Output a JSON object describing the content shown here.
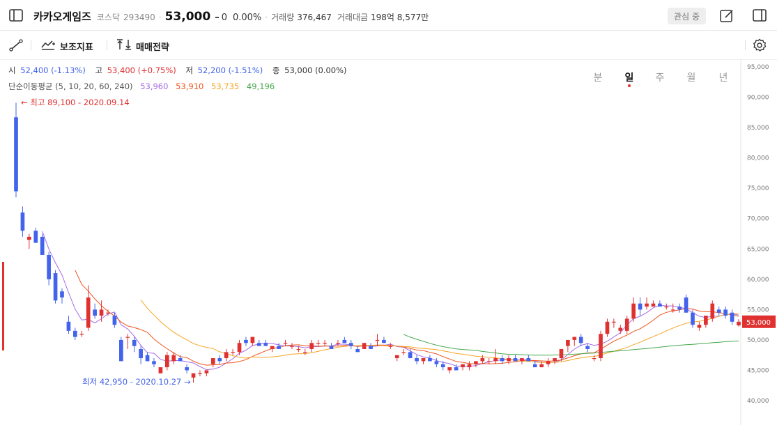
{
  "header": {
    "stock_name": "카카오게임즈",
    "market": "코스닥",
    "code": "293490",
    "price": "53,000",
    "change_arrow": "–",
    "change_value": "0",
    "change_pct": "0.00%",
    "volume_label": "거래량",
    "volume_value": "376,467",
    "amount_label": "거래대금",
    "amount_value": "198억 8,577만",
    "watch_label": "관심 중"
  },
  "toolbar": {
    "indicator_label": "보조지표",
    "strategy_label": "매매전략",
    "periods": [
      "분",
      "일",
      "주",
      "월",
      "년"
    ],
    "active_period": "일"
  },
  "info": {
    "open_label": "시",
    "open_value": "52,400 (-1.13%)",
    "high_label": "고",
    "high_value": "53,400 (+0.75%)",
    "low_label": "저",
    "low_value": "52,200 (-1.51%)",
    "close_label": "종",
    "close_value": "53,000 (0.00%)",
    "ma_label": "단순이동평균 (5, 10, 20, 60, 240)",
    "ma_values": [
      "53,960",
      "53,910",
      "53,735",
      "49,196"
    ]
  },
  "annotations": {
    "max_label": "← 최고 89,100 - 2020.09.14",
    "min_label": "최저 42,950 - 2020.10.27 →",
    "current_price_tag": "53,000"
  },
  "colors": {
    "up": "#e03131",
    "down": "#4263eb",
    "ma5": "#a36ae8",
    "ma10": "#f0531c",
    "ma20": "#f5a524",
    "ma60": "#46a84b"
  },
  "chart_data": {
    "type": "candlestick",
    "y_axis_ticks": [
      "95,000",
      "90,000",
      "85,000",
      "80,000",
      "75,000",
      "70,000",
      "65,000",
      "60,000",
      "55,000",
      "50,000",
      "45,000",
      "40,000"
    ],
    "ylim": [
      40000,
      95000
    ],
    "candles": [
      [
        86700,
        89100,
        73500,
        74500
      ],
      [
        71000,
        72000,
        67000,
        68000
      ],
      [
        66500,
        67500,
        65000,
        67000
      ],
      [
        68000,
        68500,
        66000,
        66000
      ],
      [
        67000,
        67500,
        64000,
        64000
      ],
      [
        64000,
        64500,
        59000,
        60000
      ],
      [
        61000,
        61500,
        56000,
        56500
      ],
      [
        58000,
        58500,
        56000,
        57000
      ],
      [
        53000,
        54000,
        51000,
        51500
      ],
      [
        51500,
        52000,
        50000,
        50500
      ],
      [
        51000,
        51500,
        50500,
        51000
      ],
      [
        52000,
        59000,
        51500,
        57000
      ],
      [
        55000,
        56000,
        53500,
        54000
      ],
      [
        54000,
        56500,
        53000,
        55000
      ],
      [
        54500,
        55000,
        54000,
        54500
      ],
      [
        54000,
        54500,
        52000,
        52500
      ],
      [
        50000,
        50500,
        46500,
        46500
      ],
      [
        50500,
        51000,
        48500,
        50500
      ],
      [
        50000,
        50500,
        48000,
        49000
      ],
      [
        48500,
        49000,
        46000,
        47000
      ],
      [
        47500,
        48000,
        46500,
        46500
      ],
      [
        46500,
        47000,
        45500,
        46000
      ],
      [
        44500,
        45000,
        44500,
        45500
      ],
      [
        45500,
        48000,
        45000,
        47500
      ],
      [
        46500,
        48000,
        46000,
        47500
      ],
      [
        47000,
        47500,
        46500,
        46500
      ],
      [
        45500,
        46000,
        44500,
        45000
      ],
      [
        43800,
        44500,
        42950,
        44500
      ],
      [
        44500,
        45000,
        44000,
        44500
      ],
      [
        44500,
        45000,
        44000,
        45000
      ],
      [
        46000,
        47000,
        45500,
        47000
      ],
      [
        47000,
        47500,
        46000,
        46500
      ],
      [
        47000,
        48500,
        46500,
        48000
      ],
      [
        48000,
        48500,
        47500,
        48000
      ],
      [
        48000,
        50000,
        47500,
        49500
      ],
      [
        50000,
        50500,
        49000,
        49500
      ],
      [
        49500,
        50500,
        49000,
        50500
      ],
      [
        49500,
        50000,
        49000,
        49000
      ],
      [
        49500,
        50000,
        49000,
        49000
      ],
      [
        48500,
        49000,
        48000,
        49000
      ],
      [
        49000,
        49500,
        48500,
        48500
      ],
      [
        49500,
        50000,
        49000,
        49500
      ],
      [
        49000,
        49500,
        48500,
        49000
      ],
      [
        48500,
        49000,
        48000,
        48500
      ],
      [
        48000,
        48500,
        47500,
        48000
      ],
      [
        48500,
        50000,
        48000,
        49500
      ],
      [
        49500,
        50000,
        49000,
        49500
      ],
      [
        49500,
        50000,
        49000,
        49500
      ],
      [
        49000,
        49500,
        48500,
        48500
      ],
      [
        49500,
        50000,
        49000,
        49500
      ],
      [
        50000,
        50500,
        49500,
        49500
      ],
      [
        49500,
        50000,
        48500,
        49000
      ],
      [
        48500,
        49000,
        48000,
        48000
      ],
      [
        48500,
        49500,
        48500,
        49500
      ],
      [
        49000,
        49500,
        48500,
        48500
      ],
      [
        50000,
        51000,
        49000,
        50000
      ],
      [
        50000,
        50500,
        49500,
        49500
      ],
      [
        49000,
        49500,
        48500,
        49000
      ],
      [
        47000,
        47500,
        46500,
        47500
      ],
      [
        48000,
        48500,
        47500,
        48000
      ],
      [
        48000,
        48500,
        47000,
        47000
      ],
      [
        47000,
        47500,
        46000,
        46500
      ],
      [
        46500,
        47000,
        46000,
        47000
      ],
      [
        47000,
        47500,
        46500,
        46500
      ],
      [
        46500,
        47000,
        45500,
        46000
      ],
      [
        46000,
        46500,
        45000,
        45500
      ],
      [
        45000,
        45500,
        44500,
        45500
      ],
      [
        45500,
        46000,
        45000,
        45000
      ],
      [
        45500,
        46000,
        45000,
        46000
      ],
      [
        45500,
        46500,
        45000,
        46000
      ],
      [
        46000,
        46500,
        45500,
        46500
      ],
      [
        46500,
        47500,
        46000,
        47000
      ],
      [
        46500,
        47000,
        46000,
        46500
      ],
      [
        46500,
        48500,
        46000,
        47000
      ],
      [
        47000,
        47500,
        46000,
        46500
      ],
      [
        46500,
        47500,
        46000,
        47000
      ],
      [
        47000,
        47500,
        46500,
        46500
      ],
      [
        46500,
        47000,
        46000,
        47000
      ],
      [
        47000,
        47500,
        46500,
        46500
      ],
      [
        46000,
        46500,
        45500,
        45500
      ],
      [
        45500,
        46500,
        45500,
        46000
      ],
      [
        46000,
        47000,
        45500,
        46500
      ],
      [
        46500,
        47000,
        46000,
        47000
      ],
      [
        47000,
        48500,
        46500,
        48500
      ],
      [
        49000,
        50000,
        48000,
        50000
      ],
      [
        50000,
        50500,
        49000,
        50500
      ],
      [
        50500,
        51000,
        49000,
        49500
      ],
      [
        49000,
        49500,
        48000,
        48500
      ],
      [
        47000,
        47500,
        46500,
        47000
      ],
      [
        47000,
        51500,
        46500,
        51000
      ],
      [
        51000,
        53500,
        50500,
        53000
      ],
      [
        53000,
        53500,
        52000,
        53000
      ],
      [
        51500,
        52500,
        51000,
        52000
      ],
      [
        51500,
        54000,
        51000,
        53500
      ],
      [
        53500,
        57000,
        53000,
        56000
      ],
      [
        56000,
        57000,
        54000,
        55000
      ],
      [
        55500,
        57000,
        55000,
        56000
      ],
      [
        55500,
        56500,
        55500,
        56000
      ],
      [
        56000,
        56500,
        55500,
        55500
      ],
      [
        55500,
        56000,
        55000,
        55500
      ],
      [
        55000,
        56000,
        54500,
        55000
      ],
      [
        55500,
        56000,
        54500,
        55000
      ],
      [
        57000,
        57500,
        54500,
        54500
      ],
      [
        54500,
        55000,
        52000,
        52500
      ],
      [
        52000,
        53000,
        51500,
        52500
      ],
      [
        52500,
        54000,
        52000,
        54000
      ],
      [
        53500,
        56500,
        53000,
        56000
      ],
      [
        55000,
        55500,
        54000,
        54500
      ],
      [
        55000,
        55500,
        53500,
        54000
      ],
      [
        54500,
        55000,
        52500,
        53000
      ],
      [
        52400,
        53400,
        52200,
        53000
      ]
    ]
  }
}
